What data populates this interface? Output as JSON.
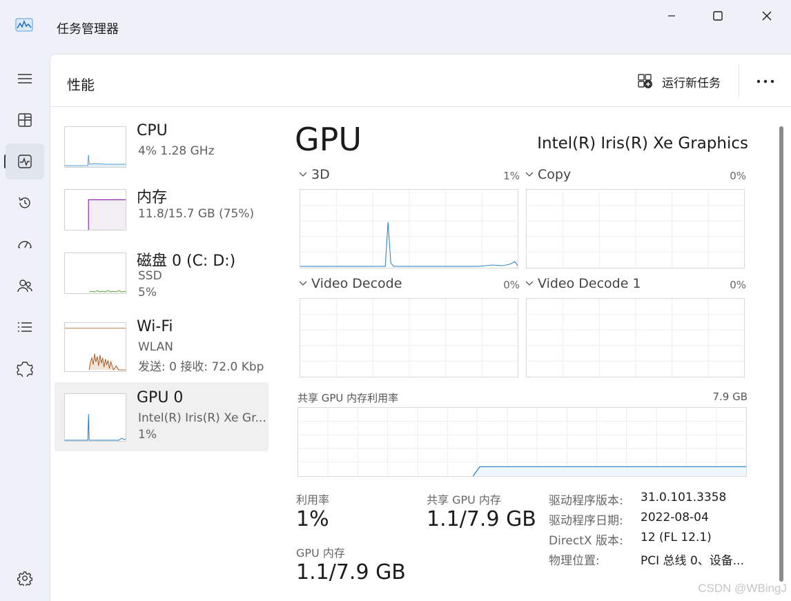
{
  "window": {
    "title": "任务管理器",
    "controls": [
      "minimize-icon",
      "maximize-icon",
      "close-icon"
    ]
  },
  "nav": {
    "items": [
      {
        "icon": "hamburger-menu-icon"
      },
      {
        "icon": "processes-icon"
      },
      {
        "icon": "performance-icon",
        "active": true
      },
      {
        "icon": "app-history-icon"
      },
      {
        "icon": "startup-apps-icon"
      },
      {
        "icon": "users-icon"
      },
      {
        "icon": "details-icon"
      },
      {
        "icon": "services-icon"
      },
      {
        "icon": "settings-icon"
      }
    ]
  },
  "header": {
    "title": "性能",
    "run_task_label": "运行新任务",
    "run_task_icon": "run-new-task-icon",
    "more_icon": "more-icon"
  },
  "resources": [
    {
      "name": "CPU",
      "sub1": "4%  1.28 GHz",
      "sub2": "",
      "sub3": "",
      "color": "#1a7dc4"
    },
    {
      "name": "内存",
      "sub1": "11.8/15.7 GB (75%)",
      "sub2": "",
      "sub3": "",
      "color": "#8b2aa8"
    },
    {
      "name": "磁盘 0 (C: D:)",
      "sub1": "SSD",
      "sub2": "5%",
      "sub3": "",
      "color": "#4aa82a"
    },
    {
      "name": "Wi-Fi",
      "sub1": "WLAN",
      "sub2": "发送: 0  接收: 72.0 Kbp",
      "sub3": "",
      "color": "#a7561b"
    },
    {
      "name": "GPU 0",
      "sub1": "Intel(R) Iris(R) Xe Gr...",
      "sub2": "1%",
      "sub3": "",
      "color": "#1a7dc4",
      "selected": true
    }
  ],
  "gpu": {
    "title": "GPU",
    "model": "Intel(R) Iris(R) Xe Graphics",
    "engines": [
      {
        "label": "3D",
        "percent": "1%"
      },
      {
        "label": "Copy",
        "percent": "0%"
      },
      {
        "label": "Video Decode",
        "percent": "0%"
      },
      {
        "label": "Video Decode 1",
        "percent": "0%"
      }
    ],
    "shared_mem_graph_label": "共享 GPU 内存利用率",
    "shared_mem_graph_max": "7.9 GB",
    "stats": {
      "utilization_label": "利用率",
      "utilization_value": "1%",
      "shared_mem_label": "共享 GPU 内存",
      "shared_mem_value": "1.1/7.9 GB",
      "gpu_mem_label": "GPU 内存",
      "gpu_mem_value": "1.1/7.9 GB"
    },
    "info": [
      {
        "key": "驱动程序版本:",
        "value": "31.0.101.3358"
      },
      {
        "key": "驱动程序日期:",
        "value": "2022-08-04"
      },
      {
        "key": "DirectX 版本:",
        "value": "12 (FL 12.1)"
      },
      {
        "key": "物理位置:",
        "value": "PCI 总线 0、设备..."
      }
    ]
  },
  "watermark": "CSDN @WBingJ",
  "colors": {
    "gpu_line": "#1a7dc4",
    "memory_line": "#8b2aa8",
    "disk_line": "#4aa82a",
    "wifi_line": "#a7561b",
    "active_nav_bg": "#e1e6ee"
  }
}
